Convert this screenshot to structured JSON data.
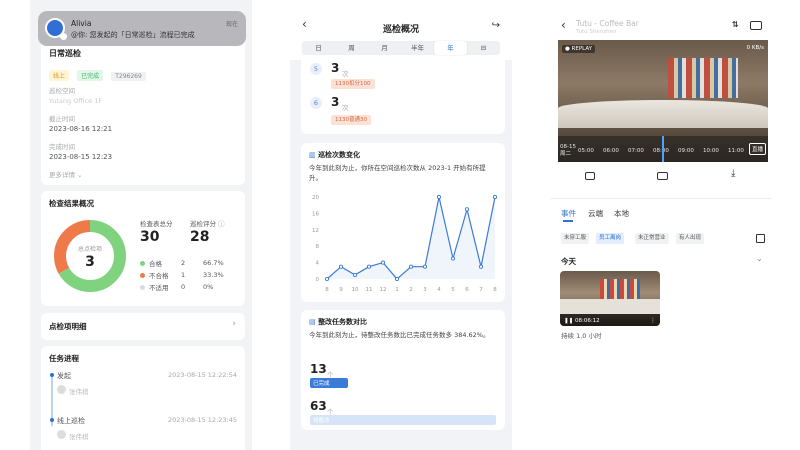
{
  "phone1": {
    "notification": {
      "sender": "Alivia",
      "time": "现在",
      "message": "@你: 您发起的「日常巡检」流程已完成"
    },
    "task": {
      "title": "日常巡检",
      "tags": [
        "线上",
        "已完成",
        "T296269"
      ],
      "space_label": "巡检空间",
      "space_value": "Yutang Office 1F",
      "deadline_label": "截止时间",
      "deadline_value": "2023-08-16 12:21",
      "finish_label": "完成时间",
      "finish_value": "2023-08-15 12:23",
      "more": "更多详情"
    },
    "overview": {
      "title": "检查结果概况",
      "total_label": "检查表总分",
      "total_value": "30",
      "score_label": "巡检评分",
      "score_value": "28",
      "donut_label": "总点检项",
      "donut_value": "3",
      "legend": [
        {
          "name": "合格",
          "count": "2",
          "percent": "66.7%",
          "color": "#7fd37f"
        },
        {
          "name": "不合格",
          "count": "1",
          "percent": "33.3%",
          "color": "#ee7a4a"
        },
        {
          "name": "不适用",
          "count": "0",
          "percent": "0%",
          "color": "#dcdcdc"
        }
      ]
    },
    "details_link": "点检项明细",
    "progress": {
      "title": "任务进程",
      "steps": [
        {
          "label": "发起",
          "time": "2023-08-15 12:22:54",
          "user": "张伟棋"
        },
        {
          "label": "线上巡检",
          "time": "2023-08-15 12:23:45",
          "user": "张伟棋"
        }
      ]
    }
  },
  "phone2": {
    "header_title": "巡检概况",
    "periods": [
      "日",
      "周",
      "月",
      "半年",
      "年",
      "⊟"
    ],
    "active_period": "年",
    "rank_rows": [
      {
        "rank": "5",
        "count": "3",
        "unit": "次",
        "tag": "1130扣分100"
      },
      {
        "rank": "6",
        "count": "3",
        "unit": "次",
        "tag": "1130普通30"
      }
    ],
    "trend": {
      "title": "巡检次数变化",
      "desc": "今年到此刻为止，你所在空间巡检次数从 2023-1 开始有所提升。"
    },
    "rectify": {
      "title": "整改任务数对比",
      "desc": "今年到此刻为止，待整改任务数比已完成任务数多 384.62%。",
      "done_value": "13",
      "done_unit": "个",
      "done_label": "已完成",
      "todo_value": "63",
      "todo_unit": "个",
      "todo_label": "待整改"
    },
    "chart_data": {
      "type": "line",
      "title": "巡检次数变化",
      "categories": [
        "8",
        "9",
        "10",
        "11",
        "12",
        "1",
        "2",
        "3",
        "4",
        "5",
        "6",
        "7",
        "8"
      ],
      "values": [
        0,
        3,
        1,
        3,
        4,
        0,
        3,
        3,
        20,
        5,
        17,
        3,
        20
      ],
      "yticks": [
        "0",
        "4",
        "8",
        "12",
        "16",
        "20"
      ],
      "ylim": [
        0,
        20
      ],
      "xlabel": "",
      "ylabel": "",
      "grid": false,
      "line_color": "#3b7bd8"
    }
  },
  "phone3": {
    "store_name": "Tutu - Coffee Bar",
    "store_sub": "Tutu Shenzhen",
    "replay_badge": "● REPLAY",
    "bitrate": "0 KB/s",
    "timeline_date": "08-15 周二",
    "timeline_ticks": [
      "05:00",
      "06:00",
      "07:00",
      "08:00",
      "09:00",
      "10:00",
      "11:00"
    ],
    "live_button": "直播",
    "tabs": [
      "事件",
      "云端",
      "本地"
    ],
    "active_tab": "事件",
    "filters": [
      "未穿工服",
      "员工离岗",
      "未正常营业",
      "有人出现"
    ],
    "active_filter": "员工离岗",
    "today_label": "今天",
    "clip_time": "08:06:12",
    "clip_desc": "持续 1.0 小时"
  }
}
